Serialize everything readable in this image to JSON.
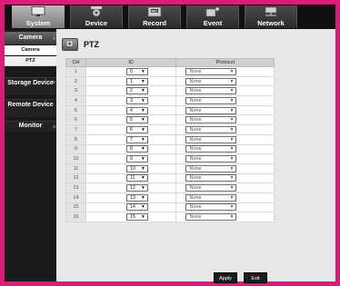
{
  "nav": {
    "tabs": [
      {
        "label": "System",
        "icon": "monitor-icon",
        "active": true
      },
      {
        "label": "Device",
        "icon": "camera-device-icon",
        "active": false
      },
      {
        "label": "Record",
        "icon": "rec-icon",
        "active": false
      },
      {
        "label": "Event",
        "icon": "event-icon",
        "active": false
      },
      {
        "label": "Network",
        "icon": "network-icon",
        "active": false
      }
    ]
  },
  "sidebar": {
    "camera": "Camera",
    "camera_sub": "Camera",
    "ptz": "PTZ",
    "storage": "Storage Device",
    "remote": "Remote Device",
    "monitor": "Monitor"
  },
  "panel": {
    "title": "PTZ",
    "columns": {
      "ch": "CH",
      "id": "ID",
      "protocol": "Protocol"
    },
    "rows": [
      {
        "ch": "1",
        "id": "0",
        "protocol": "None"
      },
      {
        "ch": "2",
        "id": "1",
        "protocol": "None"
      },
      {
        "ch": "3",
        "id": "2",
        "protocol": "None"
      },
      {
        "ch": "4",
        "id": "3",
        "protocol": "None"
      },
      {
        "ch": "5",
        "id": "4",
        "protocol": "None"
      },
      {
        "ch": "6",
        "id": "5",
        "protocol": "None"
      },
      {
        "ch": "7",
        "id": "6",
        "protocol": "None"
      },
      {
        "ch": "8",
        "id": "7",
        "protocol": "None"
      },
      {
        "ch": "9",
        "id": "8",
        "protocol": "None"
      },
      {
        "ch": "10",
        "id": "9",
        "protocol": "None"
      },
      {
        "ch": "11",
        "id": "10",
        "protocol": "None"
      },
      {
        "ch": "12",
        "id": "11",
        "protocol": "None"
      },
      {
        "ch": "13",
        "id": "12",
        "protocol": "None"
      },
      {
        "ch": "14",
        "id": "13",
        "protocol": "None"
      },
      {
        "ch": "15",
        "id": "14",
        "protocol": "None"
      },
      {
        "ch": "16",
        "id": "15",
        "protocol": "None"
      }
    ]
  },
  "buttons": {
    "apply": "Apply",
    "exit": "Exit"
  },
  "colors": {
    "frame": "#d81e7a",
    "nav_bg": "#111111"
  }
}
